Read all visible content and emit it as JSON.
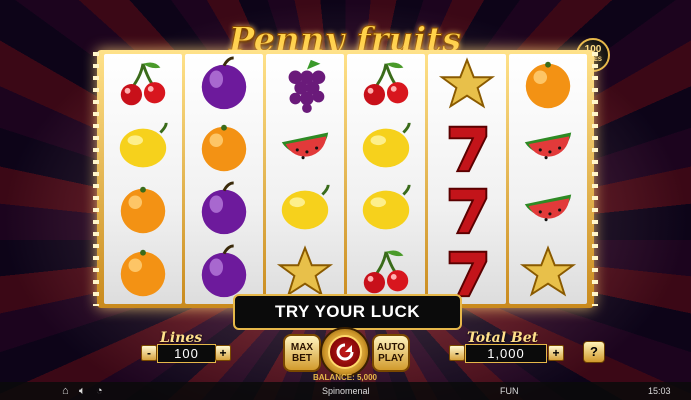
{
  "game": {
    "title": "Penny fruits",
    "lines_badge": {
      "count": "100",
      "label": "LINES"
    }
  },
  "reels": [
    [
      "cherry",
      "lemon",
      "orange",
      "orange"
    ],
    [
      "plum",
      "orange",
      "plum",
      "plum"
    ],
    [
      "grapes",
      "watermelon",
      "lemon",
      "star"
    ],
    [
      "cherry",
      "lemon",
      "lemon",
      "cherry"
    ],
    [
      "star",
      "seven",
      "seven",
      "seven"
    ],
    [
      "orange",
      "watermelon",
      "watermelon",
      "star"
    ]
  ],
  "controls": {
    "message": "TRY YOUR LUCK",
    "lines_label": "Lines",
    "lines_value": "100",
    "total_bet_label": "Total Bet",
    "total_bet_value": "1,000",
    "minus": "-",
    "plus": "+",
    "max_bet_label": "MAX BET",
    "auto_play_label": "AUTO PLAY",
    "help_label": "?",
    "balance_text": "BALANCE: 5,000"
  },
  "status_bar": {
    "icons": [
      "home-icon",
      "sound-icon",
      "speed-icon"
    ],
    "provider": "Spinomenal",
    "mode": "FUN",
    "time": "15:03"
  },
  "colors": {
    "gold": "#e6b84a",
    "frame": "#0b0b0b"
  }
}
